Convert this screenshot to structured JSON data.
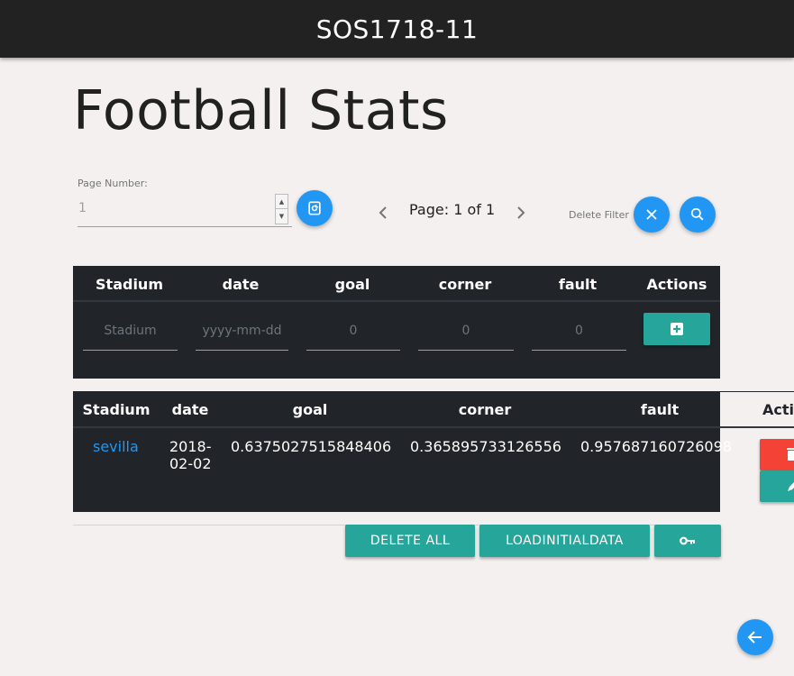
{
  "header": {
    "title": "SOS1718-11"
  },
  "page": {
    "title": "Football Stats"
  },
  "pagination": {
    "page_number_label": "Page Number:",
    "page_number_value": "1",
    "page_text": "Page: 1 of 1",
    "delete_filter_label": "Delete Filter"
  },
  "form": {
    "headers": [
      "Stadium",
      "date",
      "goal",
      "corner",
      "fault",
      "Actions"
    ],
    "placeholders": [
      "Stadium",
      "yyyy-mm-dd",
      "0",
      "0",
      "0"
    ]
  },
  "table": {
    "headers": [
      "Stadium",
      "date",
      "goal",
      "corner",
      "fault",
      "Actions"
    ],
    "rows": [
      {
        "stadium": "sevilla",
        "date_line1": "2018-",
        "date_line2": "02-02",
        "goal": "0.6375027515848406",
        "corner": "0.365895733126556",
        "fault": "0.957687160726098"
      }
    ]
  },
  "actions": {
    "delete_all": "DELETE ALL",
    "load_initial": "LOADINITIALDATA"
  },
  "colors": {
    "primary": "#2196f3",
    "teal": "#26a69a",
    "danger": "#f44336",
    "dark": "#212529",
    "topbar": "#222222"
  },
  "icons": [
    "refresh-icon",
    "chevron-left-icon",
    "chevron-right-icon",
    "close-icon",
    "search-icon",
    "plus-square-icon",
    "trash-icon",
    "pencil-icon",
    "key-icon",
    "arrow-left-icon"
  ]
}
